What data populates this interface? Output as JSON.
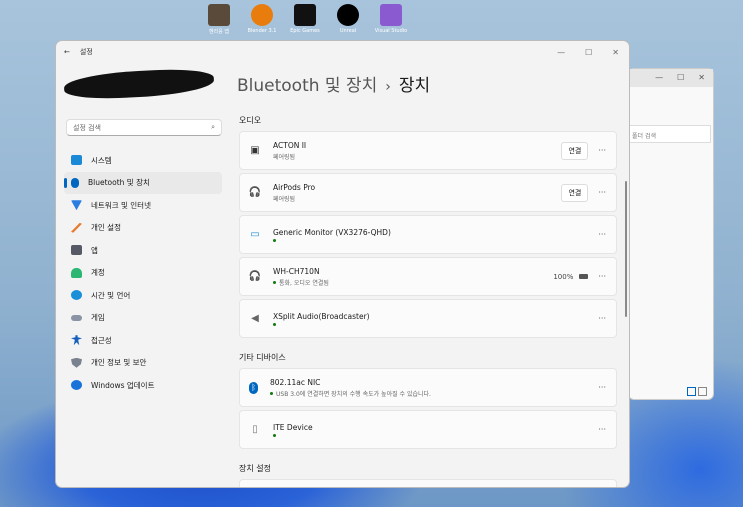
{
  "desktop": {
    "icons": [
      {
        "label": "헨리응 앱",
        "color": "#5a4a3a"
      },
      {
        "label": "Blender 3.1",
        "color": "#e87d0d"
      },
      {
        "label": "Epic Games",
        "color": "#111111"
      },
      {
        "label": "Unreal",
        "color": "#000000"
      },
      {
        "label": "Visual Studio",
        "color": "#8a5ad0"
      }
    ]
  },
  "back_window": {
    "search_placeholder": "폴더 검색",
    "min": "—",
    "max": "☐",
    "close": "✕"
  },
  "window": {
    "title": "설정",
    "back": "←",
    "min": "—",
    "max": "☐",
    "close": "✕"
  },
  "sidebar": {
    "search_placeholder": "설정 검색",
    "search_icon": "⌕",
    "items": [
      {
        "label": "시스템",
        "color": "#1b8ad6"
      },
      {
        "label": "Bluetooth 및 장치",
        "color": "#0067c0"
      },
      {
        "label": "네트워크 및 인터넷",
        "color": "#2a7de1"
      },
      {
        "label": "개인 설정",
        "color": "#e67b2e"
      },
      {
        "label": "앱",
        "color": "#555a66"
      },
      {
        "label": "계정",
        "color": "#2bb673"
      },
      {
        "label": "시간 및 언어",
        "color": "#1a8fd8"
      },
      {
        "label": "게임",
        "color": "#8a94a4"
      },
      {
        "label": "접근성",
        "color": "#1560bd"
      },
      {
        "label": "개인 정보 및 보안",
        "color": "#7a8290"
      },
      {
        "label": "Windows 업데이트",
        "color": "#1a73d9"
      }
    ]
  },
  "header": {
    "parent": "Bluetooth 및 장치",
    "sep": "›",
    "current": "장치"
  },
  "audio": {
    "title": "오디오",
    "devices": [
      {
        "name": "ACTON II",
        "status": "페어링됨",
        "icon": "▣",
        "button": "연결",
        "connected": false
      },
      {
        "name": "AirPods Pro",
        "status": "페어링됨",
        "icon": "🎧",
        "button": "연결",
        "connected": false
      },
      {
        "name": "Generic Monitor (VX3276-QHD)",
        "status": "",
        "icon": "▭",
        "connected": true
      },
      {
        "name": "WH-CH710N",
        "status": "통화, 오디오 연결됨",
        "icon": "🎧",
        "battery": "100%",
        "connected": true
      },
      {
        "name": "XSplit Audio(Broadcaster)",
        "status": "",
        "icon": "◀",
        "connected": true
      }
    ]
  },
  "other": {
    "title": "기타 디바이스",
    "devices": [
      {
        "name": "802.11ac NIC",
        "status": "USB 3.0에 연결하면 장치의 수행 속도가 높아질 수 있습니다.",
        "icon": "ᛒ",
        "connected": true
      },
      {
        "name": "ITE Device",
        "status": "",
        "icon": "▯",
        "connected": true
      }
    ]
  },
  "settings": {
    "title": "장치 설정"
  },
  "more_label": "···"
}
